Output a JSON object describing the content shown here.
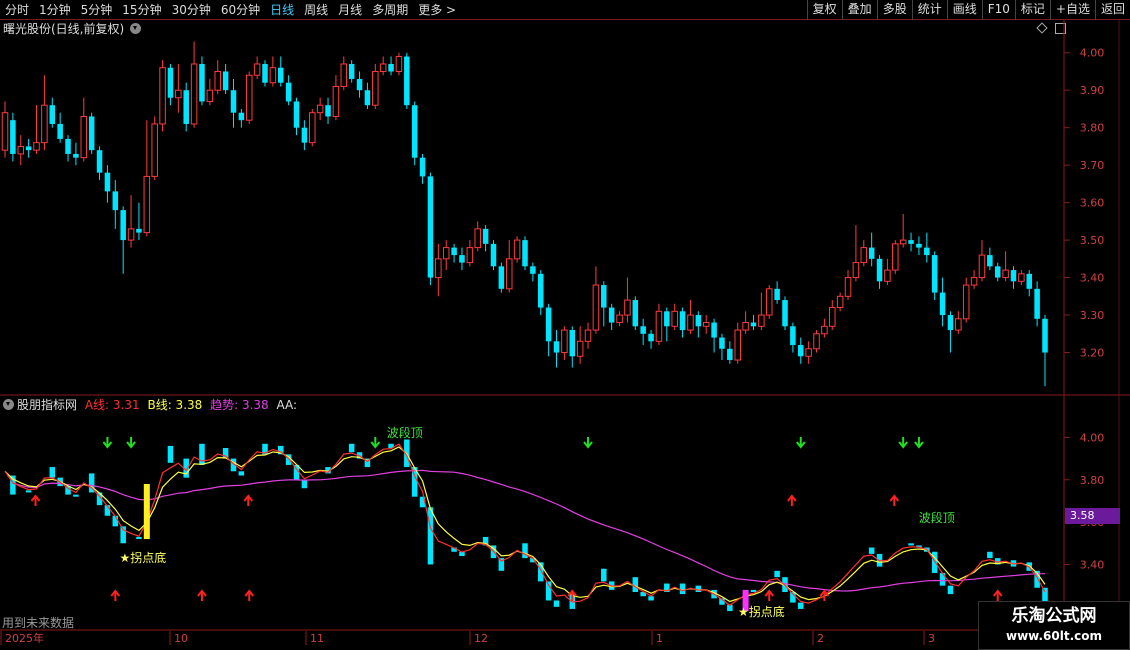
{
  "toolbar": {
    "periods": [
      "分时",
      "1分钟",
      "5分钟",
      "15分钟",
      "30分钟",
      "60分钟",
      "日线",
      "周线",
      "月线",
      "多周期",
      "更多 >"
    ],
    "active_period": "日线",
    "right_buttons": [
      "复权",
      "叠加",
      "多股",
      "统计",
      "画线",
      "F10",
      "标记",
      "+自选",
      "返回"
    ]
  },
  "main_panel": {
    "title": "曙光股份(日线,前复权)",
    "axis_labels": [
      "4.00",
      "3.90",
      "3.80",
      "3.70",
      "3.60",
      "3.50",
      "3.40",
      "3.30",
      "3.20"
    ]
  },
  "indicator_panel": {
    "name": "股朋指标网",
    "a_label": "A线: 3.31",
    "b_label": "B线: 3.38",
    "trend_label": "趋势: 3.38",
    "aa_label": "AA:",
    "axis_labels": [
      "4.00",
      "3.80",
      "3.60",
      "3.40",
      "3.20"
    ],
    "current_tag": "3.58",
    "annotations": {
      "wave_top": "波段顶",
      "turning_bottom": "★拐点底"
    },
    "future_data_note": "用到未来数据"
  },
  "time_axis": [
    "2025年",
    "10",
    "11",
    "12",
    "1",
    "2",
    "3"
  ],
  "watermark": {
    "line1": "乐淘公式网",
    "line2": "www.60lt.com"
  },
  "colors": {
    "up": "#ff3b3b",
    "down": "#00e5ff",
    "a_line": "#ff3030",
    "b_line": "#ffff40",
    "trend": "#e040e0",
    "signal_up": "#ff2020",
    "signal_down": "#20e020"
  },
  "chart_data": {
    "type": "candlestick",
    "price_range": [
      3.1,
      4.05
    ],
    "candles": [
      [
        3.74,
        3.84,
        3.72,
        3.87
      ],
      [
        3.82,
        3.73,
        3.71,
        3.84
      ],
      [
        3.73,
        3.75,
        3.7,
        3.78
      ],
      [
        3.75,
        3.74,
        3.72,
        3.77
      ],
      [
        3.74,
        3.76,
        3.73,
        3.86
      ],
      [
        3.76,
        3.86,
        3.74,
        3.94
      ],
      [
        3.86,
        3.81,
        3.8,
        3.88
      ],
      [
        3.81,
        3.77,
        3.76,
        3.84
      ],
      [
        3.77,
        3.73,
        3.71,
        3.78
      ],
      [
        3.73,
        3.72,
        3.7,
        3.76
      ],
      [
        3.72,
        3.83,
        3.71,
        3.88
      ],
      [
        3.83,
        3.74,
        3.73,
        3.84
      ],
      [
        3.74,
        3.68,
        3.66,
        3.75
      ],
      [
        3.68,
        3.63,
        3.6,
        3.7
      ],
      [
        3.63,
        3.58,
        3.53,
        3.66
      ],
      [
        3.58,
        3.5,
        3.41,
        3.59
      ],
      [
        3.5,
        3.53,
        3.48,
        3.62
      ],
      [
        3.53,
        3.52,
        3.5,
        3.6
      ],
      [
        3.52,
        3.67,
        3.51,
        3.82
      ],
      [
        3.67,
        3.81,
        3.66,
        3.83
      ],
      [
        3.81,
        3.96,
        3.79,
        3.98
      ],
      [
        3.96,
        3.88,
        3.86,
        3.97
      ],
      [
        3.88,
        3.9,
        3.84,
        3.97
      ],
      [
        3.9,
        3.81,
        3.79,
        3.92
      ],
      [
        3.81,
        3.97,
        3.8,
        4.03
      ],
      [
        3.97,
        3.87,
        3.86,
        3.99
      ],
      [
        3.87,
        3.9,
        3.86,
        3.93
      ],
      [
        3.9,
        3.95,
        3.89,
        3.98
      ],
      [
        3.95,
        3.9,
        3.89,
        3.97
      ],
      [
        3.9,
        3.84,
        3.8,
        3.93
      ],
      [
        3.84,
        3.82,
        3.8,
        3.85
      ],
      [
        3.82,
        3.94,
        3.81,
        3.95
      ],
      [
        3.94,
        3.97,
        3.93,
        3.99
      ],
      [
        3.97,
        3.92,
        3.91,
        3.98
      ],
      [
        3.92,
        3.96,
        3.91,
        3.99
      ],
      [
        3.96,
        3.92,
        3.91,
        3.99
      ],
      [
        3.92,
        3.87,
        3.86,
        3.94
      ],
      [
        3.87,
        3.8,
        3.78,
        3.88
      ],
      [
        3.8,
        3.76,
        3.74,
        3.82
      ],
      [
        3.76,
        3.84,
        3.75,
        3.85
      ],
      [
        3.84,
        3.86,
        3.82,
        3.88
      ],
      [
        3.86,
        3.83,
        3.81,
        3.88
      ],
      [
        3.83,
        3.91,
        3.82,
        3.94
      ],
      [
        3.91,
        3.97,
        3.9,
        3.99
      ],
      [
        3.97,
        3.93,
        3.92,
        3.98
      ],
      [
        3.93,
        3.9,
        3.88,
        3.95
      ],
      [
        3.9,
        3.86,
        3.85,
        3.92
      ],
      [
        3.86,
        3.95,
        3.85,
        3.97
      ],
      [
        3.95,
        3.97,
        3.94,
        3.99
      ],
      [
        3.97,
        3.95,
        3.94,
        3.99
      ],
      [
        3.95,
        3.99,
        3.94,
        4.0
      ],
      [
        3.99,
        3.86,
        3.85,
        4.0
      ],
      [
        3.86,
        3.72,
        3.7,
        3.87
      ],
      [
        3.72,
        3.67,
        3.65,
        3.73
      ],
      [
        3.67,
        3.4,
        3.38,
        3.68
      ],
      [
        3.4,
        3.45,
        3.35,
        3.49
      ],
      [
        3.45,
        3.48,
        3.42,
        3.5
      ],
      [
        3.48,
        3.46,
        3.44,
        3.49
      ],
      [
        3.46,
        3.44,
        3.42,
        3.48
      ],
      [
        3.44,
        3.48,
        3.43,
        3.5
      ],
      [
        3.48,
        3.53,
        3.47,
        3.55
      ],
      [
        3.53,
        3.49,
        3.47,
        3.54
      ],
      [
        3.49,
        3.43,
        3.42,
        3.5
      ],
      [
        3.43,
        3.37,
        3.36,
        3.44
      ],
      [
        3.37,
        3.45,
        3.36,
        3.5
      ],
      [
        3.45,
        3.5,
        3.44,
        3.51
      ],
      [
        3.5,
        3.43,
        3.42,
        3.51
      ],
      [
        3.43,
        3.41,
        3.39,
        3.44
      ],
      [
        3.41,
        3.32,
        3.3,
        3.42
      ],
      [
        3.32,
        3.23,
        3.19,
        3.33
      ],
      [
        3.23,
        3.2,
        3.16,
        3.26
      ],
      [
        3.2,
        3.26,
        3.18,
        3.27
      ],
      [
        3.26,
        3.19,
        3.16,
        3.27
      ],
      [
        3.19,
        3.23,
        3.17,
        3.27
      ],
      [
        3.23,
        3.26,
        3.21,
        3.28
      ],
      [
        3.26,
        3.38,
        3.25,
        3.43
      ],
      [
        3.38,
        3.32,
        3.27,
        3.39
      ],
      [
        3.32,
        3.28,
        3.26,
        3.33
      ],
      [
        3.28,
        3.3,
        3.27,
        3.31
      ],
      [
        3.3,
        3.34,
        3.28,
        3.4
      ],
      [
        3.34,
        3.27,
        3.26,
        3.35
      ],
      [
        3.27,
        3.25,
        3.22,
        3.29
      ],
      [
        3.25,
        3.23,
        3.21,
        3.26
      ],
      [
        3.23,
        3.31,
        3.22,
        3.33
      ],
      [
        3.31,
        3.27,
        3.23,
        3.32
      ],
      [
        3.27,
        3.31,
        3.26,
        3.33
      ],
      [
        3.31,
        3.26,
        3.24,
        3.32
      ],
      [
        3.26,
        3.3,
        3.25,
        3.34
      ],
      [
        3.3,
        3.27,
        3.24,
        3.31
      ],
      [
        3.27,
        3.28,
        3.25,
        3.3
      ],
      [
        3.28,
        3.24,
        3.2,
        3.29
      ],
      [
        3.24,
        3.21,
        3.18,
        3.25
      ],
      [
        3.21,
        3.18,
        3.17,
        3.23
      ],
      [
        3.18,
        3.26,
        3.17,
        3.28
      ],
      [
        3.26,
        3.28,
        3.25,
        3.31
      ],
      [
        3.28,
        3.27,
        3.26,
        3.3
      ],
      [
        3.27,
        3.3,
        3.26,
        3.36
      ],
      [
        3.3,
        3.37,
        3.29,
        3.38
      ],
      [
        3.37,
        3.34,
        3.33,
        3.39
      ],
      [
        3.34,
        3.27,
        3.26,
        3.35
      ],
      [
        3.27,
        3.22,
        3.2,
        3.28
      ],
      [
        3.22,
        3.19,
        3.17,
        3.24
      ],
      [
        3.19,
        3.21,
        3.17,
        3.23
      ],
      [
        3.21,
        3.25,
        3.2,
        3.26
      ],
      [
        3.25,
        3.27,
        3.24,
        3.29
      ],
      [
        3.27,
        3.32,
        3.26,
        3.34
      ],
      [
        3.32,
        3.35,
        3.31,
        3.36
      ],
      [
        3.35,
        3.4,
        3.34,
        3.42
      ],
      [
        3.4,
        3.44,
        3.39,
        3.54
      ],
      [
        3.44,
        3.48,
        3.43,
        3.5
      ],
      [
        3.48,
        3.45,
        3.43,
        3.52
      ],
      [
        3.45,
        3.39,
        3.37,
        3.46
      ],
      [
        3.39,
        3.42,
        3.38,
        3.45
      ],
      [
        3.42,
        3.49,
        3.41,
        3.5
      ],
      [
        3.49,
        3.5,
        3.48,
        3.57
      ],
      [
        3.5,
        3.49,
        3.47,
        3.52
      ],
      [
        3.49,
        3.48,
        3.46,
        3.51
      ],
      [
        3.48,
        3.46,
        3.44,
        3.52
      ],
      [
        3.46,
        3.36,
        3.34,
        3.47
      ],
      [
        3.36,
        3.3,
        3.27,
        3.4
      ],
      [
        3.3,
        3.26,
        3.2,
        3.31
      ],
      [
        3.26,
        3.29,
        3.25,
        3.31
      ],
      [
        3.29,
        3.38,
        3.28,
        3.4
      ],
      [
        3.38,
        3.4,
        3.37,
        3.42
      ],
      [
        3.4,
        3.46,
        3.39,
        3.5
      ],
      [
        3.46,
        3.43,
        3.42,
        3.48
      ],
      [
        3.43,
        3.4,
        3.39,
        3.44
      ],
      [
        3.4,
        3.42,
        3.39,
        3.47
      ],
      [
        3.42,
        3.39,
        3.37,
        3.43
      ],
      [
        3.39,
        3.41,
        3.38,
        3.42
      ],
      [
        3.41,
        3.37,
        3.35,
        3.42
      ],
      [
        3.37,
        3.29,
        3.27,
        3.39
      ],
      [
        3.29,
        3.2,
        3.11,
        3.3
      ]
    ]
  }
}
